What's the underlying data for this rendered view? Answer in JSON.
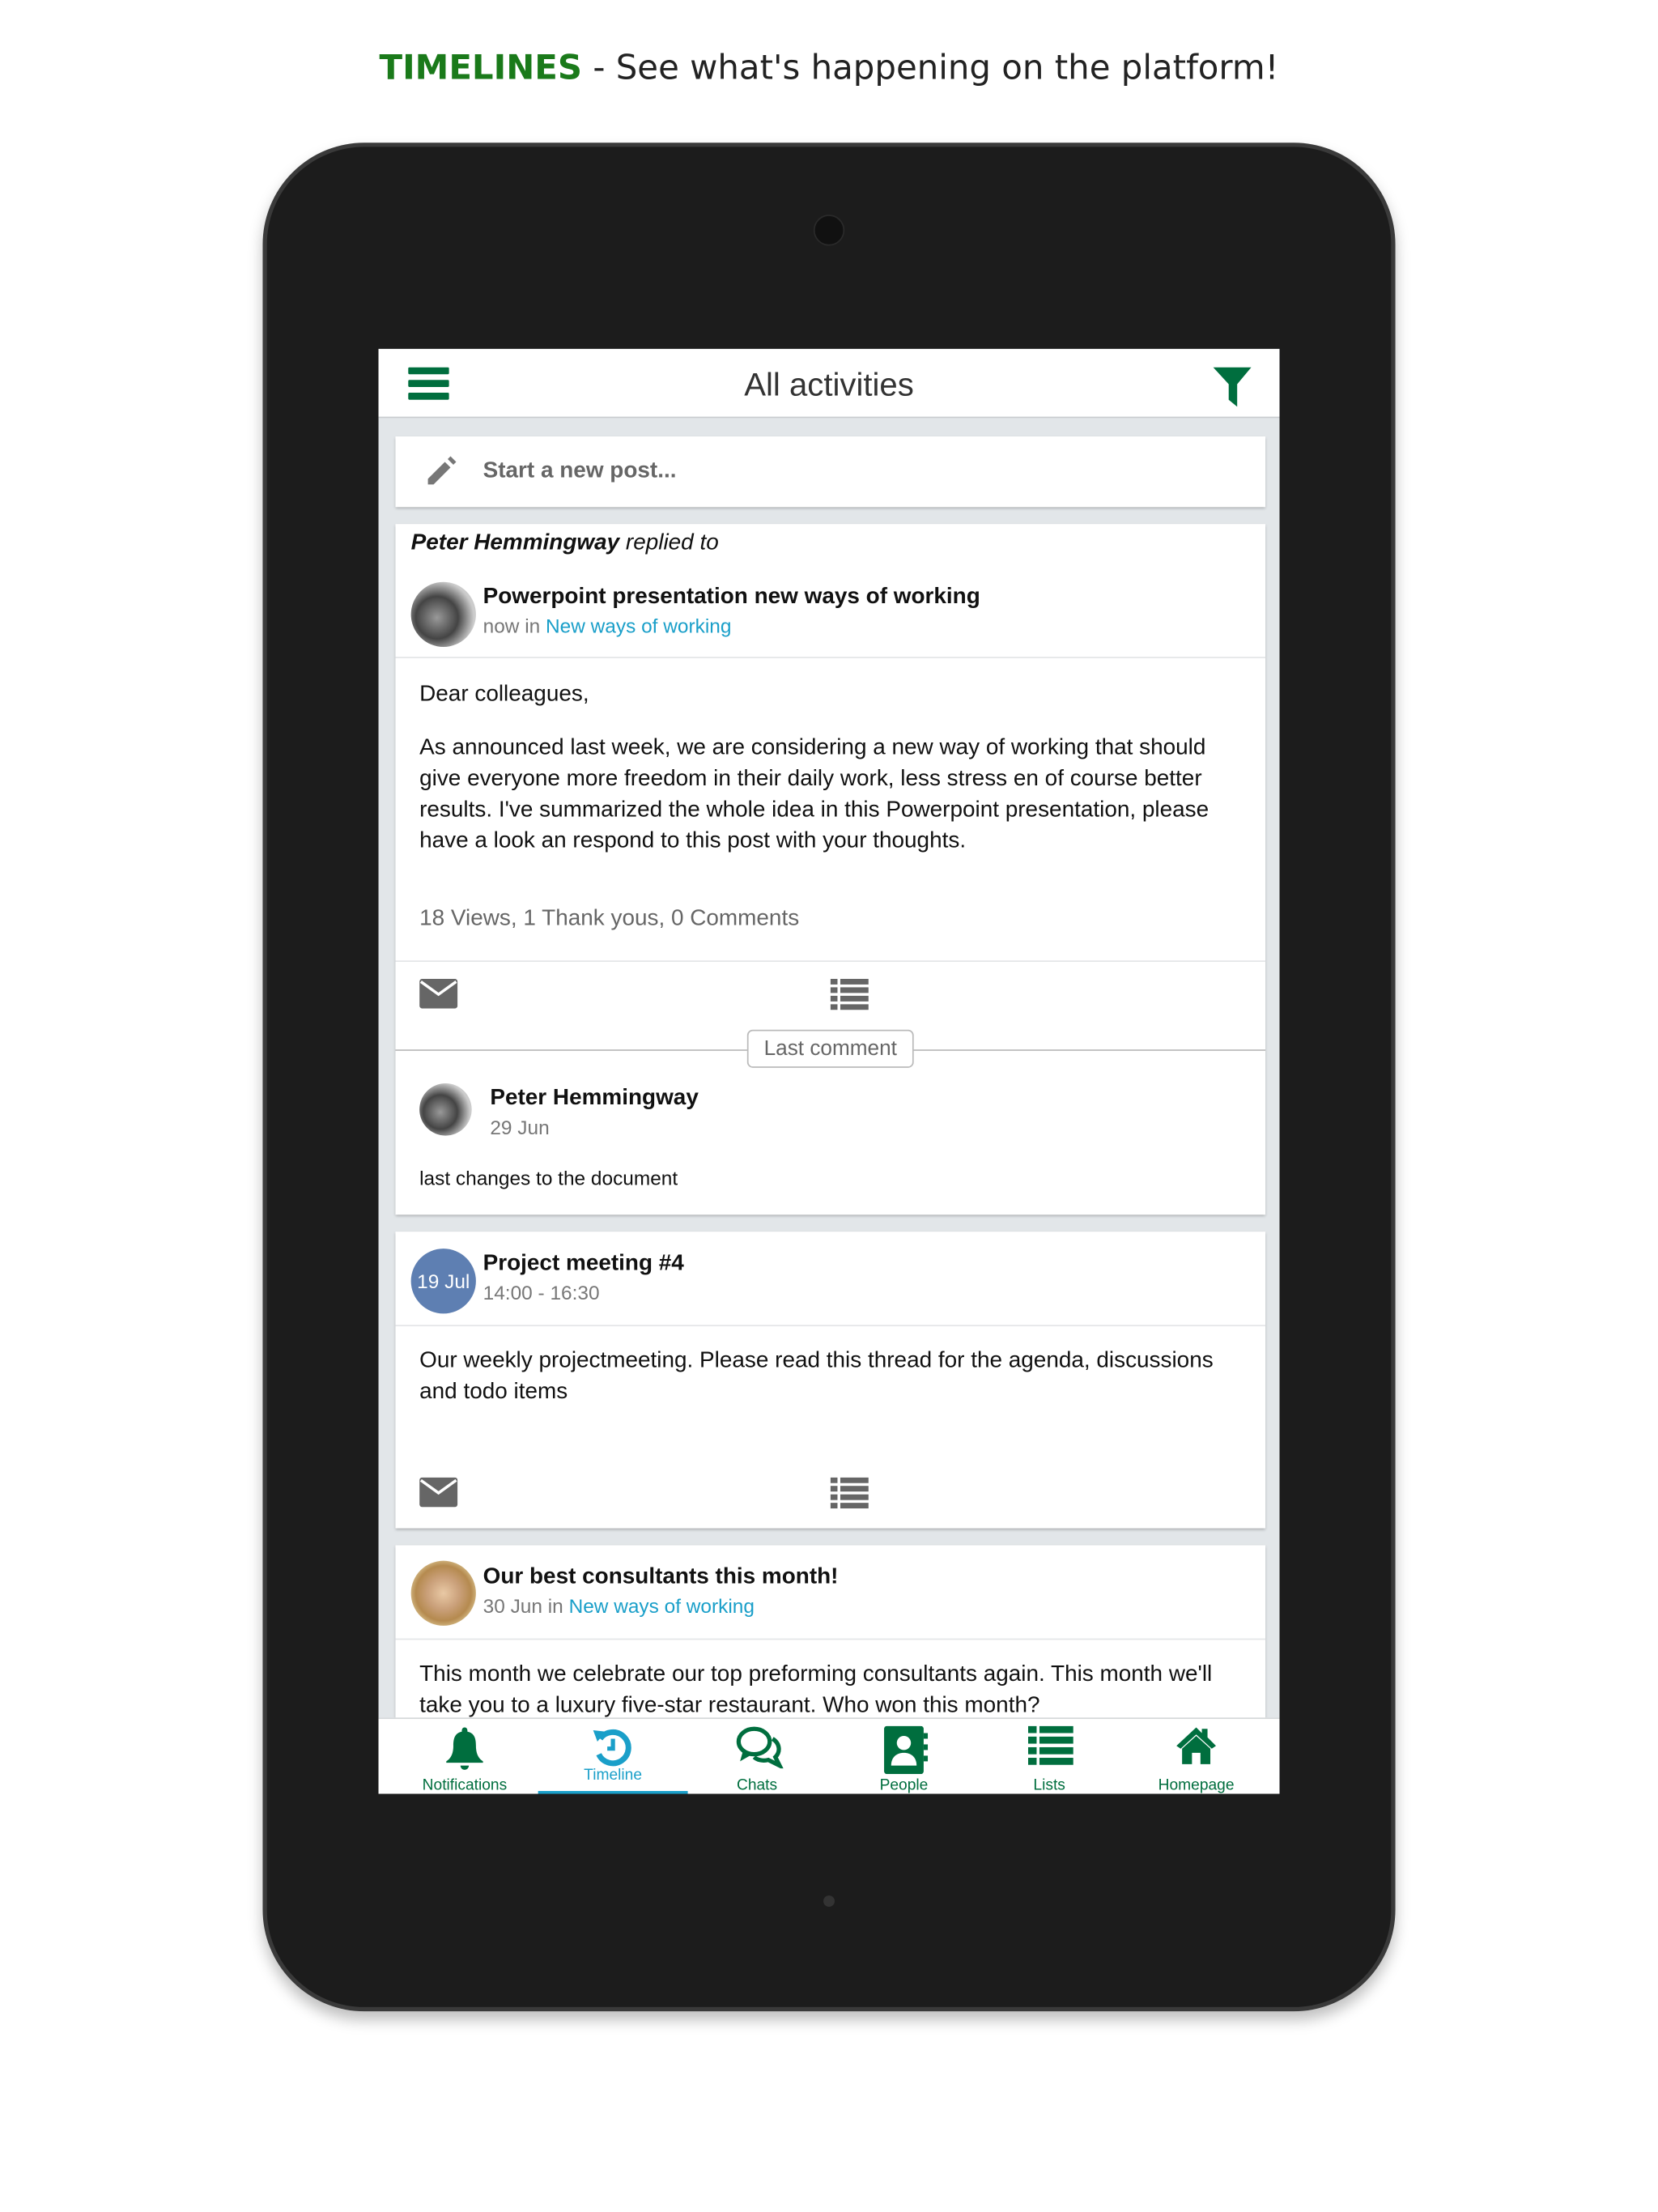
{
  "headline": {
    "brand": "TIMELINES",
    "rest": " - See what's happening on the platform!"
  },
  "colors": {
    "brand_green": "#006e3e",
    "link": "#1a9fc9",
    "event_badge": "#5e7fb2"
  },
  "header": {
    "title": "All activities",
    "menu_icon": "hamburger-icon",
    "filter_icon": "filter-icon"
  },
  "composer": {
    "placeholder": "Start a new post..."
  },
  "posts": [
    {
      "actor": "Peter Hemmingway",
      "action": " replied to",
      "title": "Powerpoint presentation new ways of working",
      "time": "now",
      "in": " in ",
      "group": "New ways of working",
      "greeting": "Dear colleagues,",
      "body": "As announced last week, we are considering a new way of working that should give everyone more freedom in their daily work, less stress en of course better results. I've summarized the whole idea in this Powerpoint presentation, please have a look an respond to this post with your thoughts.",
      "stats": "18 Views, 1 Thank yous, 0 Comments",
      "last_comment_label": "Last comment",
      "comment": {
        "author": "Peter Hemmingway",
        "date": "29 Jun",
        "text": "last changes to the document"
      }
    },
    {
      "badge": "19 Jul",
      "title": "Project meeting #4",
      "time": "14:00 - 16:30",
      "body": "Our weekly projectmeeting. Please read this thread for the agenda, discussions and todo items"
    },
    {
      "title": "Our best consultants this month!",
      "time": "30 Jun",
      "in": " in ",
      "group": "New ways of working",
      "body": "This month we celebrate our top preforming consultants again. This month we'll take you to a luxury five-star restaurant. Who won this month?"
    }
  ],
  "nav": [
    {
      "label": "Notifications"
    },
    {
      "label": "Timeline",
      "active": true
    },
    {
      "label": "Chats"
    },
    {
      "label": "People"
    },
    {
      "label": "Lists"
    },
    {
      "label": "Homepage"
    }
  ]
}
